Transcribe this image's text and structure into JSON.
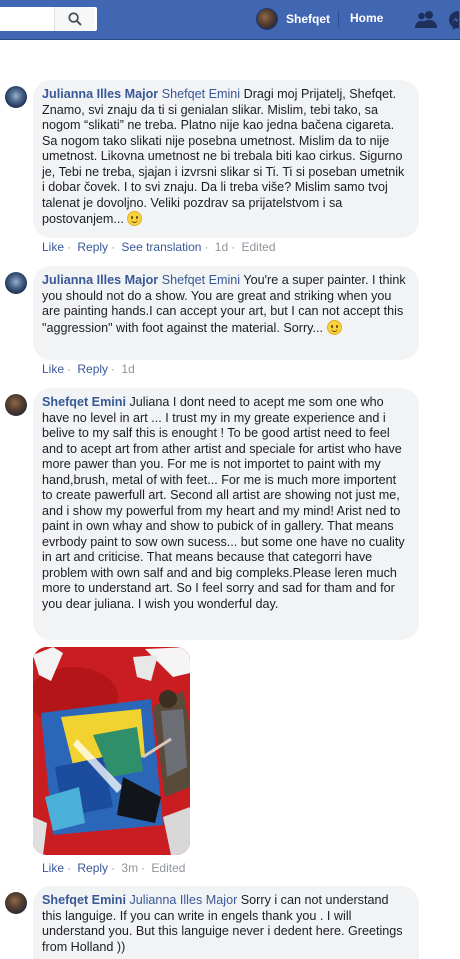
{
  "header": {
    "search_placeholder": "",
    "profile_name": "Shefqet",
    "home_label": "Home",
    "search_icon": "search-icon",
    "friends_icon": "friends-icon",
    "messages_icon": "messages-icon",
    "brand_color": "#4267b2"
  },
  "comments": [
    {
      "author": "Julianna Illes Major",
      "tagged": "Shefqet Emini",
      "text": "Dragi moj Prijatelj, Shefqet. Znamo, svi znaju da ti si genialan slikar. Mislim, tebi tako, sa nogom “slikati” ne treba. Platno nije kao jedna bačena cigareta. Sa nogom tako slikati nije posebna umetnost. Mislim da to nije umetnost. Likovna umetnost ne bi trebala biti kao cirkus. Sigurno je, Tebi ne treba, sjajan i izvrsni slikar si Ti. Ti si poseban umetnik i dobar čovek. I to svi znaju. Da li treba više? Mislim samo tvoj talenat je dovoljno. Veliki pozdrav sa prijatelstvom i sa postovanjem...",
      "like": "Like",
      "reply": "Reply",
      "translate": "See translation",
      "time": "1d",
      "edited": "Edited"
    },
    {
      "author": "Julianna Illes Major",
      "tagged": "Shefqet Emini",
      "text": "You're a super painter. I think you should not do a show. You are great and striking when you are painting hands.I can accept your art, but I can not accept this \"aggression\" with foot against the material. Sorry...",
      "like": "Like",
      "reply": "Reply",
      "time": "1d"
    },
    {
      "author": "Shefqet Emini",
      "text": "Juliana I dont need to acept me som one who have no level in art ... I trust my in my greate experience and i belive to my salf this is enought ! To be good artist need to feel and to acept art from ather artist and speciale for artist who have more pawer than you. For me is not importet to paint with my hand,brush, metal of with feet... For me is much more importent to create pawerfull art. Second all artist are showing not just me, and i show my powerful from my heart and my mind! Arist ned to paint in own whay and show to pubick of in gallery. That means evrbody paint to sow own sucess... but some one have no cuality in art and criticise. That means because that categorri have problem with own salf and and big compleks.Please leren much more to understand art. So I feel sorry and sad for tham and for you dear juliana. I wish you wonderful day.",
      "like": "Like",
      "reply": "Reply",
      "time": "3m",
      "edited": "Edited"
    },
    {
      "author": "Shefqet Emini",
      "tagged": "Julianna Illes Major",
      "text": "Sorry i can not understand this languige. If you can write in engels thank you . I will understand you. But this languige never i dedent here. Greetings from Holland ))"
    }
  ]
}
